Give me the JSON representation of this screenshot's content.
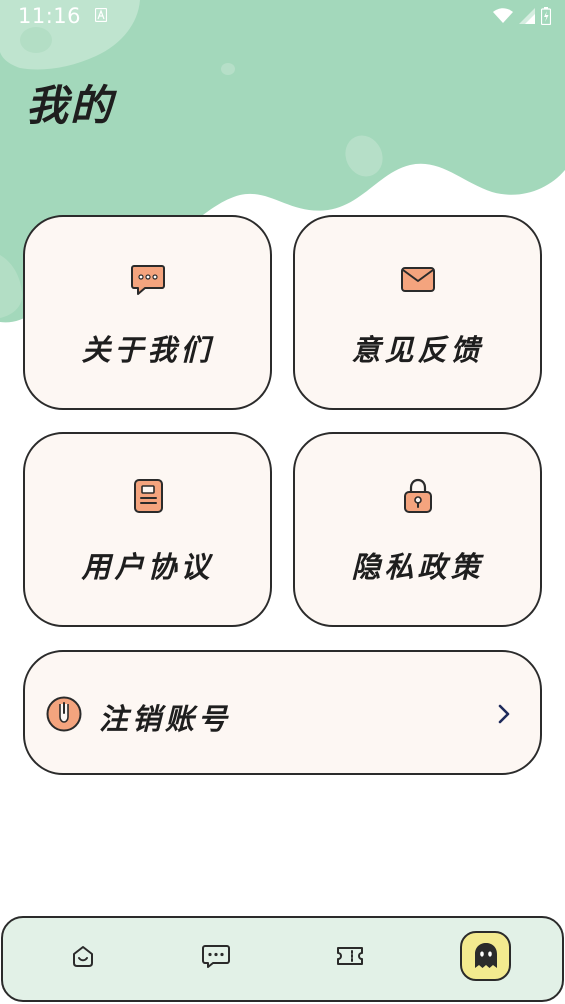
{
  "status_bar": {
    "time": "11:16",
    "text_color": "#ffffff"
  },
  "header": {
    "title": "我的",
    "bg_color": "#a3d8bb"
  },
  "menu": {
    "card_bg": "#fdf7f3",
    "icon_color": "#f4a47e",
    "items": [
      {
        "label": "关于我们",
        "icon": "chat-bubble-icon"
      },
      {
        "label": "意见反馈",
        "icon": "envelope-icon"
      },
      {
        "label": "用户协议",
        "icon": "document-icon"
      },
      {
        "label": "隐私政策",
        "icon": "lock-icon"
      }
    ]
  },
  "account_row": {
    "label": "注销账号",
    "icon": "power-icon",
    "chevron": "chevron-right-icon"
  },
  "bottom_nav": {
    "bg_color": "#e2f1e7",
    "active_bg": "#f3ea8f",
    "items": [
      {
        "icon": "home-icon",
        "active": false
      },
      {
        "icon": "message-icon",
        "active": false
      },
      {
        "icon": "ticket-icon",
        "active": false
      },
      {
        "icon": "ghost-icon",
        "active": true
      }
    ]
  }
}
